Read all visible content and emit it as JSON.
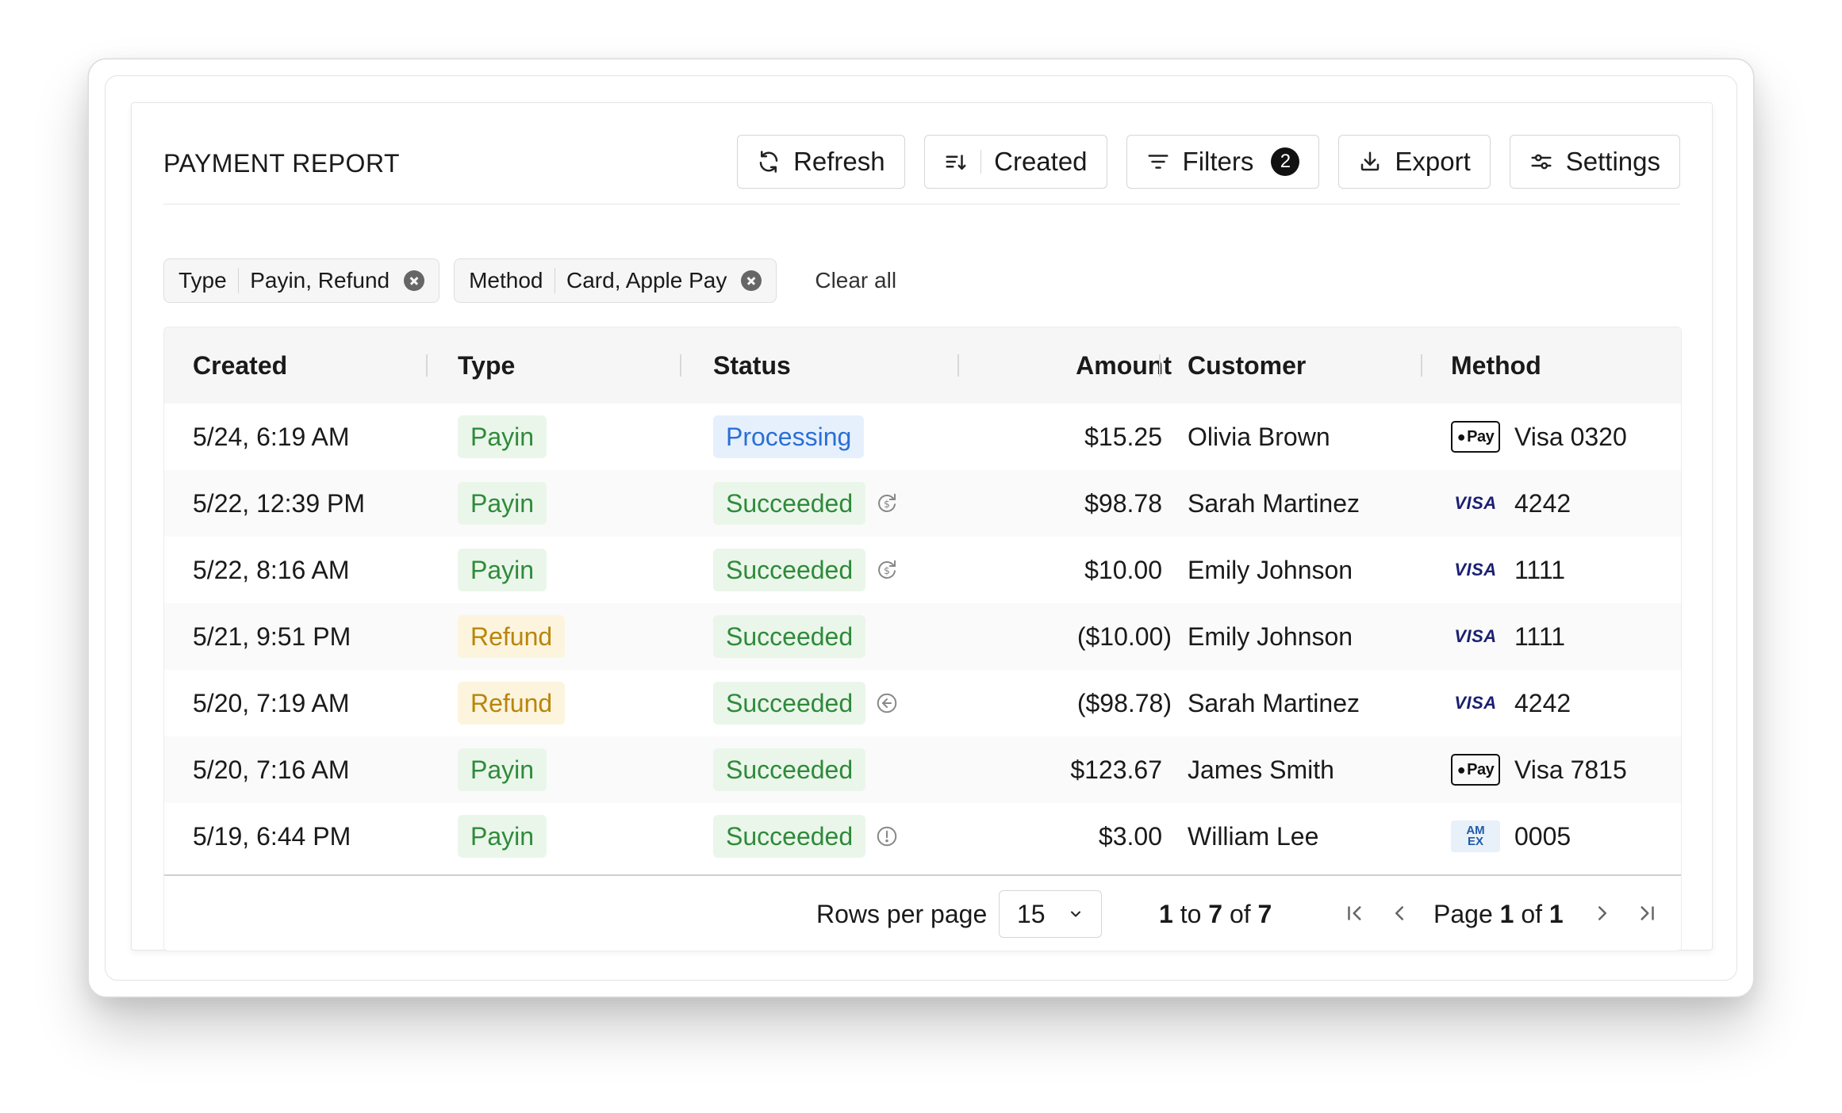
{
  "report": {
    "title": "PAYMENT REPORT",
    "toolbar": {
      "refresh_label": "Refresh",
      "sort_label": "Created",
      "filters_label": "Filters",
      "filters_count": "2",
      "export_label": "Export",
      "settings_label": "Settings"
    },
    "chips": [
      {
        "key": "Type",
        "value": "Payin, Refund"
      },
      {
        "key": "Method",
        "value": "Card, Apple Pay"
      }
    ],
    "clear_all": "Clear all",
    "columns": {
      "created": "Created",
      "type": "Type",
      "status": "Status",
      "amount": "Amount",
      "customer": "Customer",
      "method": "Method"
    },
    "rows": [
      {
        "created": "5/24, 6:19 AM",
        "type": "Payin",
        "status": "Processing",
        "amount": "$15.25",
        "customer": "Olivia Brown",
        "method": "Visa 0320",
        "logo": "apple-pay-icon"
      },
      {
        "created": "5/22, 12:39 PM",
        "type": "Payin",
        "status": "Succeeded",
        "amount": "$98.78",
        "customer": "Sarah Martinez",
        "method": "4242",
        "logo": "visa-icon",
        "status_icon": "partial-refund-icon"
      },
      {
        "created": "5/22, 8:16 AM",
        "type": "Payin",
        "status": "Succeeded",
        "amount": "$10.00",
        "customer": "Emily Johnson",
        "method": "1111",
        "logo": "visa-icon",
        "status_icon": "partial-refund-icon"
      },
      {
        "created": "5/21, 9:51 PM",
        "type": "Refund",
        "status": "Succeeded",
        "amount": "($10.00)",
        "customer": "Emily Johnson",
        "method": "1111",
        "logo": "visa-icon"
      },
      {
        "created": "5/20, 7:19 AM",
        "type": "Refund",
        "status": "Succeeded",
        "amount": "($98.78)",
        "customer": "Sarah Martinez",
        "method": "4242",
        "logo": "visa-icon",
        "status_icon": "refund-arrow-icon"
      },
      {
        "created": "5/20, 7:16 AM",
        "type": "Payin",
        "status": "Succeeded",
        "amount": "$123.67",
        "customer": "James Smith",
        "method": "Visa 7815",
        "logo": "apple-pay-icon"
      },
      {
        "created": "5/19, 6:44 PM",
        "type": "Payin",
        "status": "Succeeded",
        "amount": "$3.00",
        "customer": "William Lee",
        "method": "0005",
        "logo": "amex-icon",
        "status_icon": "alert-icon"
      }
    ],
    "logos": {
      "applepay_text": "Pay",
      "visa_text": "VISA",
      "amex_line1": "AM",
      "amex_line2": "EX"
    },
    "footer": {
      "rows_per_page_label": "Rows per page",
      "rows_per_page_value": "15",
      "range_from": "1",
      "range_to_word": "to",
      "range_to": "7",
      "range_of_word": "of",
      "range_total": "7",
      "page_word": "Page",
      "page_current": "1",
      "page_of_word": "of",
      "page_total": "1"
    },
    "colors": {
      "green_text": "#2f8a3a",
      "green_bg": "#eaf6ea",
      "yellow_text": "#b8860b",
      "yellow_bg": "#fdf4de",
      "blue_text": "#2a6fd6",
      "blue_bg": "#e6f0fd"
    }
  }
}
